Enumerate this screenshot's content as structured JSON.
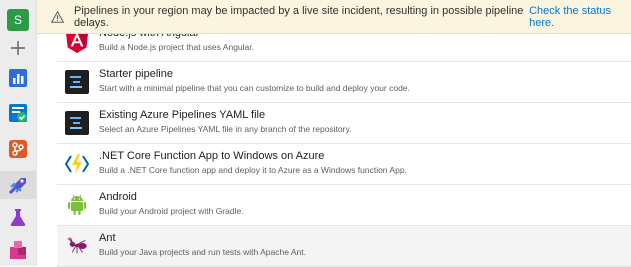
{
  "banner": {
    "message": "Pipelines in your region may be impacted by a live site incident, resulting in possible pipeline delays.",
    "link_label": "Check the status here."
  },
  "rail": {
    "avatar_letter": "S",
    "colors": {
      "avatar": "#2b9b48",
      "boards": "#0078d4",
      "repos": "#e05a26",
      "pipelines": "#5a4fcf",
      "test": "#8e3bd1",
      "artifacts": "#d63a8a"
    }
  },
  "templates": [
    {
      "title": "Node.js with Angular",
      "description": "Build a Node.js project that uses Angular.",
      "icon": "angular-icon"
    },
    {
      "title": "Starter pipeline",
      "description": "Start with a minimal pipeline that you can customize to build and deploy your code.",
      "icon": "pipeline-yaml-icon"
    },
    {
      "title": "Existing Azure Pipelines YAML file",
      "description": "Select an Azure Pipelines YAML file in any branch of the repository.",
      "icon": "pipeline-yaml-icon"
    },
    {
      "title": ".NET Core Function App to Windows on Azure",
      "description": "Build a .NET Core function app and deploy it to Azure as a Windows function App.",
      "icon": "azure-functions-icon"
    },
    {
      "title": "Android",
      "description": "Build your Android project with Gradle.",
      "icon": "android-icon"
    },
    {
      "title": "Ant",
      "description": "Build your Java projects and run tests with Apache Ant.",
      "icon": "ant-icon"
    }
  ]
}
